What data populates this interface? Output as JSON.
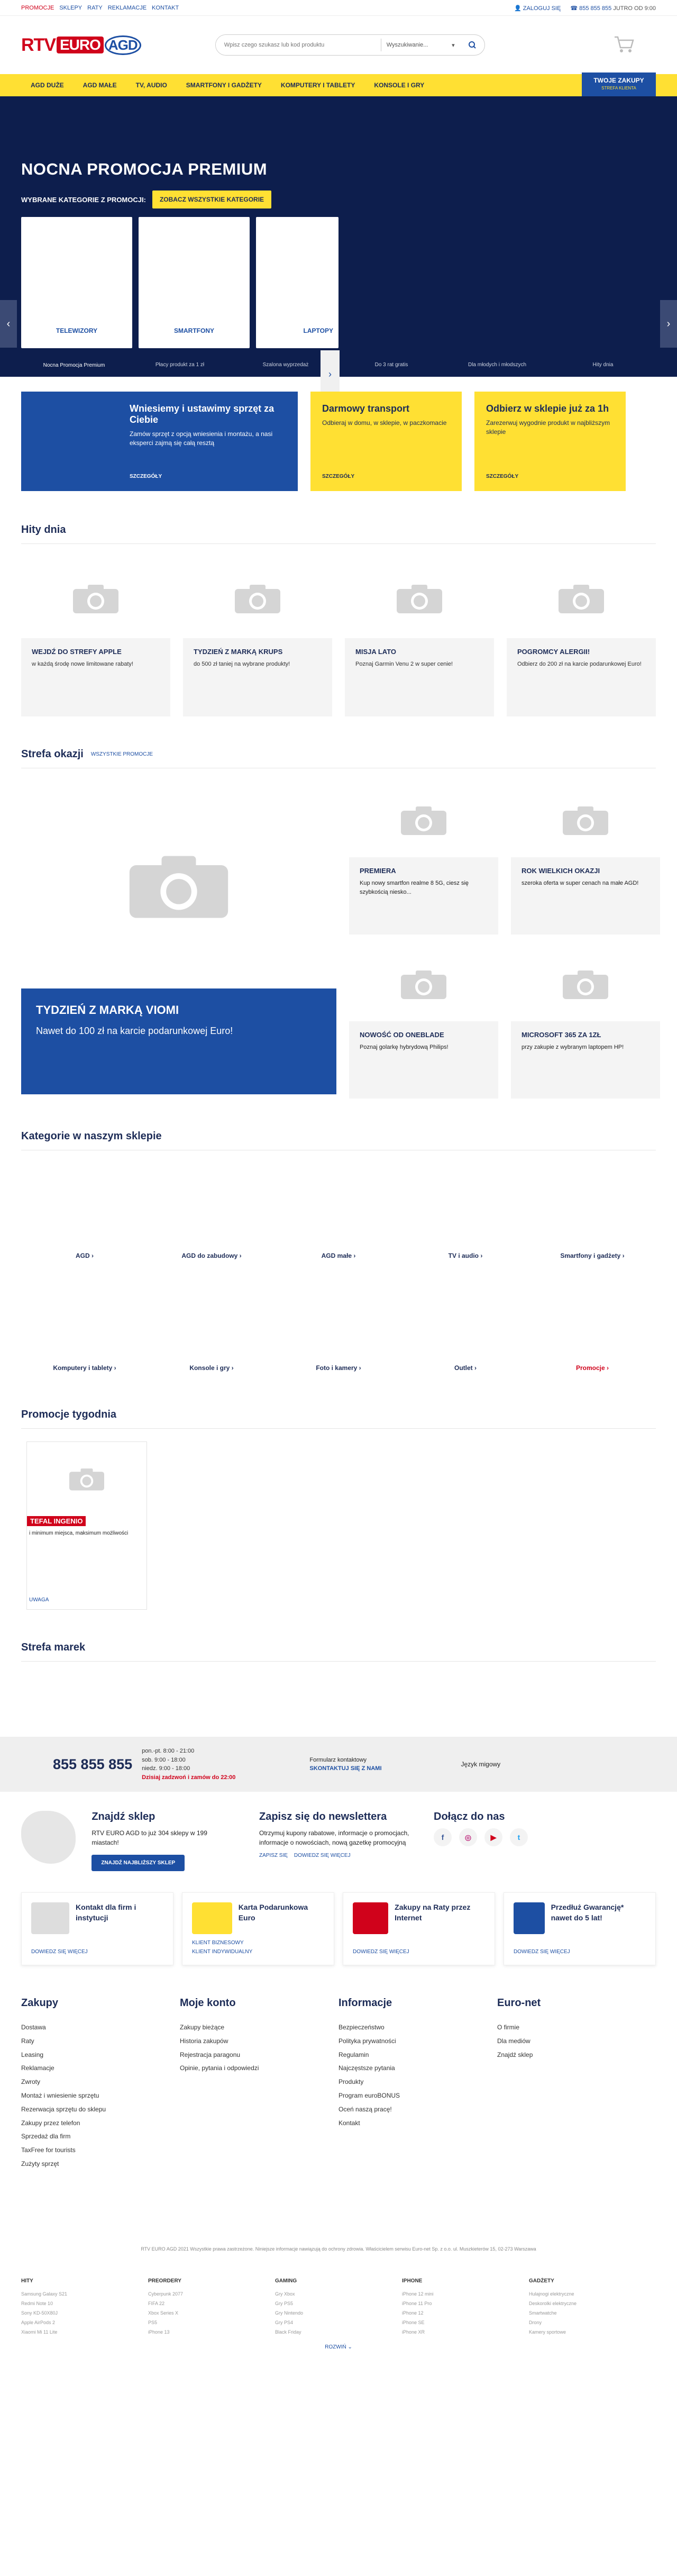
{
  "topbar": {
    "links": [
      "PROMOCJE",
      "SKLEPY",
      "RATY",
      "REKLAMACJE",
      "KONTAKT"
    ],
    "login": "ZALOGUJ SIĘ",
    "phone": "855 855 855",
    "hours": "JUTRO OD 9:00"
  },
  "search": {
    "placeholder": "Wpisz czego szukasz lub kod produktu",
    "select": "Wyszukiwanie..."
  },
  "nav": {
    "items": [
      "AGD DUŻE",
      "AGD MAŁE",
      "TV, AUDIO",
      "SMARTFONY I GADŻETY",
      "KOMPUTERY I TABLETY",
      "KONSOLE I GRY"
    ],
    "orders_label": "TWOJE ZAKUPY",
    "orders_sub": "STREFA KLIENTA"
  },
  "hero": {
    "title": "NOCNA PROMOCJA PREMIUM",
    "cat_label": "WYBRANE KATEGORIE Z PROMOCJI:",
    "see_all": "ZOBACZ WSZYSTKIE KATEGORIE",
    "cards": [
      "TELEWIZORY",
      "SMARTFONY",
      "LAPTOPY"
    ],
    "tabs": [
      "Nocna Promocja Premium",
      "Płacy produkt za 1 zł",
      "Szalona wyprzedaż",
      "Do 3 rat gratis",
      "Dla młodych i młodszych",
      "Hity dnia"
    ]
  },
  "promos": {
    "blue_title": "Wniesiemy i ustawimy sprzęt za Ciebie",
    "blue_text": "Zamów sprzęt z opcją wniesienia i montażu, a nasi eksperci zajmą się całą resztą",
    "blue_more": "SZCZEGÓŁY",
    "y1_title": "Darmowy transport",
    "y1_text": "Odbieraj w domu, w sklepie, w paczkomacie",
    "y1_more": "SZCZEGÓŁY",
    "y2_title": "Odbierz w sklepie już za 1h",
    "y2_text": "Zarezerwuj wygodnie produkt w najbliższym sklepie",
    "y2_more": "SZCZEGÓŁY"
  },
  "hits": {
    "title": "Hity dnia",
    "items": [
      {
        "title": "WEJDŹ DO STREFY APPLE",
        "text": "w każdą środę nowe limitowane rabaty!"
      },
      {
        "title": "TYDZIEŃ Z MARKĄ KRUPS",
        "text": "do 500 zł taniej na wybrane produkty!"
      },
      {
        "title": "MISJA LATO",
        "text": "Poznaj Garmin Venu 2 w super cenie!"
      },
      {
        "title": "POGROMCY ALERGII!",
        "text": "Odbierz do 200 zł na karcie podarunkowej Euro!"
      }
    ]
  },
  "deals": {
    "title": "Strefa okazji",
    "all_link": "WSZYSTKIE PROMOCJE",
    "big_title": "TYDZIEŃ Z MARKĄ VIOMI",
    "big_text": "Nawet do 100 zł na karcie podarunkowej Euro!",
    "items": [
      {
        "title": "PREMIERA",
        "text": "Kup nowy smartfon realme 8 5G, ciesz się szybkością niesko..."
      },
      {
        "title": "ROK WIELKICH OKAZJI",
        "text": "szeroka oferta w super cenach na małe AGD!"
      },
      {
        "title": "NOWOŚĆ OD ONEBLADE",
        "text": "Poznaj golarkę hybrydową Philips!"
      },
      {
        "title": "MICROSOFT 365 ZA 1ZŁ",
        "text": "przy zakupie z wybranym laptopem HP!"
      }
    ]
  },
  "categories": {
    "title": "Kategorie w naszym sklepie",
    "items": [
      "AGD",
      "AGD do zabudowy",
      "AGD małe",
      "TV i audio",
      "Smartfony i gadżety",
      "Komputery i tablety",
      "Konsole i gry",
      "Foto i kamery",
      "Outlet",
      "Promocje"
    ]
  },
  "weekly": {
    "title": "Promocje tygodnia",
    "badge": "TEFAL INGENIO",
    "text": "i minimum miejsca, maksimum możliwości",
    "more": "UWAGA"
  },
  "brands": {
    "title": "Strefa marek"
  },
  "contact": {
    "phone": "855 855 855",
    "hours": [
      "pon.-pt. 8:00 - 21:00",
      "sob. 9:00 - 18:00",
      "niedz. 9:00 - 18:00"
    ],
    "today": "Dzisiaj zadzwoń i zamów do 22:00",
    "form_label": "Formularz kontaktowy",
    "form_link": "SKONTAKTUJ SIĘ Z NAMI",
    "lang": "Język migowy"
  },
  "shop": {
    "title": "Znajdź sklep",
    "text": "RTV EURO AGD to już 304 sklepy w 199 miastach!",
    "btn": "ZNAJDŹ NAJBLIŻSZY SKLEP"
  },
  "newsletter": {
    "title": "Zapisz się do newslettera",
    "text": "Otrzymuj kupony rabatowe, informacje o promocjach, informacje o nowościach, nową gazetkę promocyjną",
    "link1": "ZAPISZ SIĘ",
    "link2": "DOWIEDZ SIĘ WIĘCEJ"
  },
  "follow": {
    "title": "Dołącz do nas"
  },
  "services": [
    {
      "title": "Kontakt dla firm i instytucji",
      "link": "DOWIEDZ SIĘ WIĘCEJ"
    },
    {
      "title": "Karta Podarunkowa Euro",
      "link": "KLIENT BIZNESOWY",
      "link2": "KLIENT INDYWIDUALNY"
    },
    {
      "title": "Zakupy na Raty przez Internet",
      "link": "DOWIEDZ SIĘ WIĘCEJ"
    },
    {
      "title": "Przedłuż Gwarancję* nawet do 5 lat!",
      "link": "DOWIEDZ SIĘ WIĘCEJ"
    }
  ],
  "footer": {
    "zakupy": {
      "title": "Zakupy",
      "items": [
        "Dostawa",
        "Raty",
        "Leasing",
        "Reklamacje",
        "Zwroty",
        "Montaż i wniesienie sprzętu",
        "Rezerwacja sprzętu do sklepu",
        "Zakupy przez telefon",
        "Sprzedaż dla firm",
        "TaxFree for tourists",
        "Zużyty sprzęt"
      ]
    },
    "konto": {
      "title": "Moje konto",
      "items": [
        "Zakupy bieżące",
        "Historia zakupów",
        "Rejestracja paragonu",
        "Opinie, pytania i odpowiedzi"
      ]
    },
    "info": {
      "title": "Informacje",
      "items": [
        "Bezpieczeństwo",
        "Polityka prywatności",
        "Regulamin",
        "Najczęstsze pytania",
        "Produkty",
        "Program euroBONUS",
        "Oceń naszą pracę!",
        "Kontakt"
      ]
    },
    "euronet": {
      "title": "Euro-net",
      "items": [
        "O firmie",
        "Dla mediów",
        "Znajdź sklep"
      ]
    }
  },
  "legal": "RTV EURO AGD 2021 Wszystkie prawa zastrzeżone. Niniejsze informacje nawiązują do ochrony zdrowia. Właścicielem serwisu Euro-net Sp. z o.o. ul. Muszkieterów 15, 02-273 Warszawa",
  "seo": [
    {
      "title": "HITY",
      "items": [
        "Samsung Galaxy S21",
        "Redmi Note 10",
        "Sony KD-50X80J",
        "Apple AirPods 2",
        "Xiaomi Mi 11 Lite"
      ]
    },
    {
      "title": "PREORDERY",
      "items": [
        "Cyberpunk 2077",
        "FIFA 22",
        "Xbox Series X",
        "PS5",
        "iPhone 13"
      ]
    },
    {
      "title": "GAMING",
      "items": [
        "Gry Xbox",
        "Gry PS5",
        "Gry Nintendo",
        "Gry PS4",
        "Black Friday"
      ]
    },
    {
      "title": "IPHONE",
      "items": [
        "iPhone 12 mini",
        "iPhone 11 Pro",
        "iPhone 12",
        "iPhone SE",
        "iPhone XR"
      ]
    },
    {
      "title": "GADŻETY",
      "items": [
        "Hulajnogi elektryczne",
        "Deskorolki elektryczne",
        "Smartwatche",
        "Drony",
        "Kamery sportowe"
      ]
    }
  ],
  "expand": "ROZWIŃ"
}
